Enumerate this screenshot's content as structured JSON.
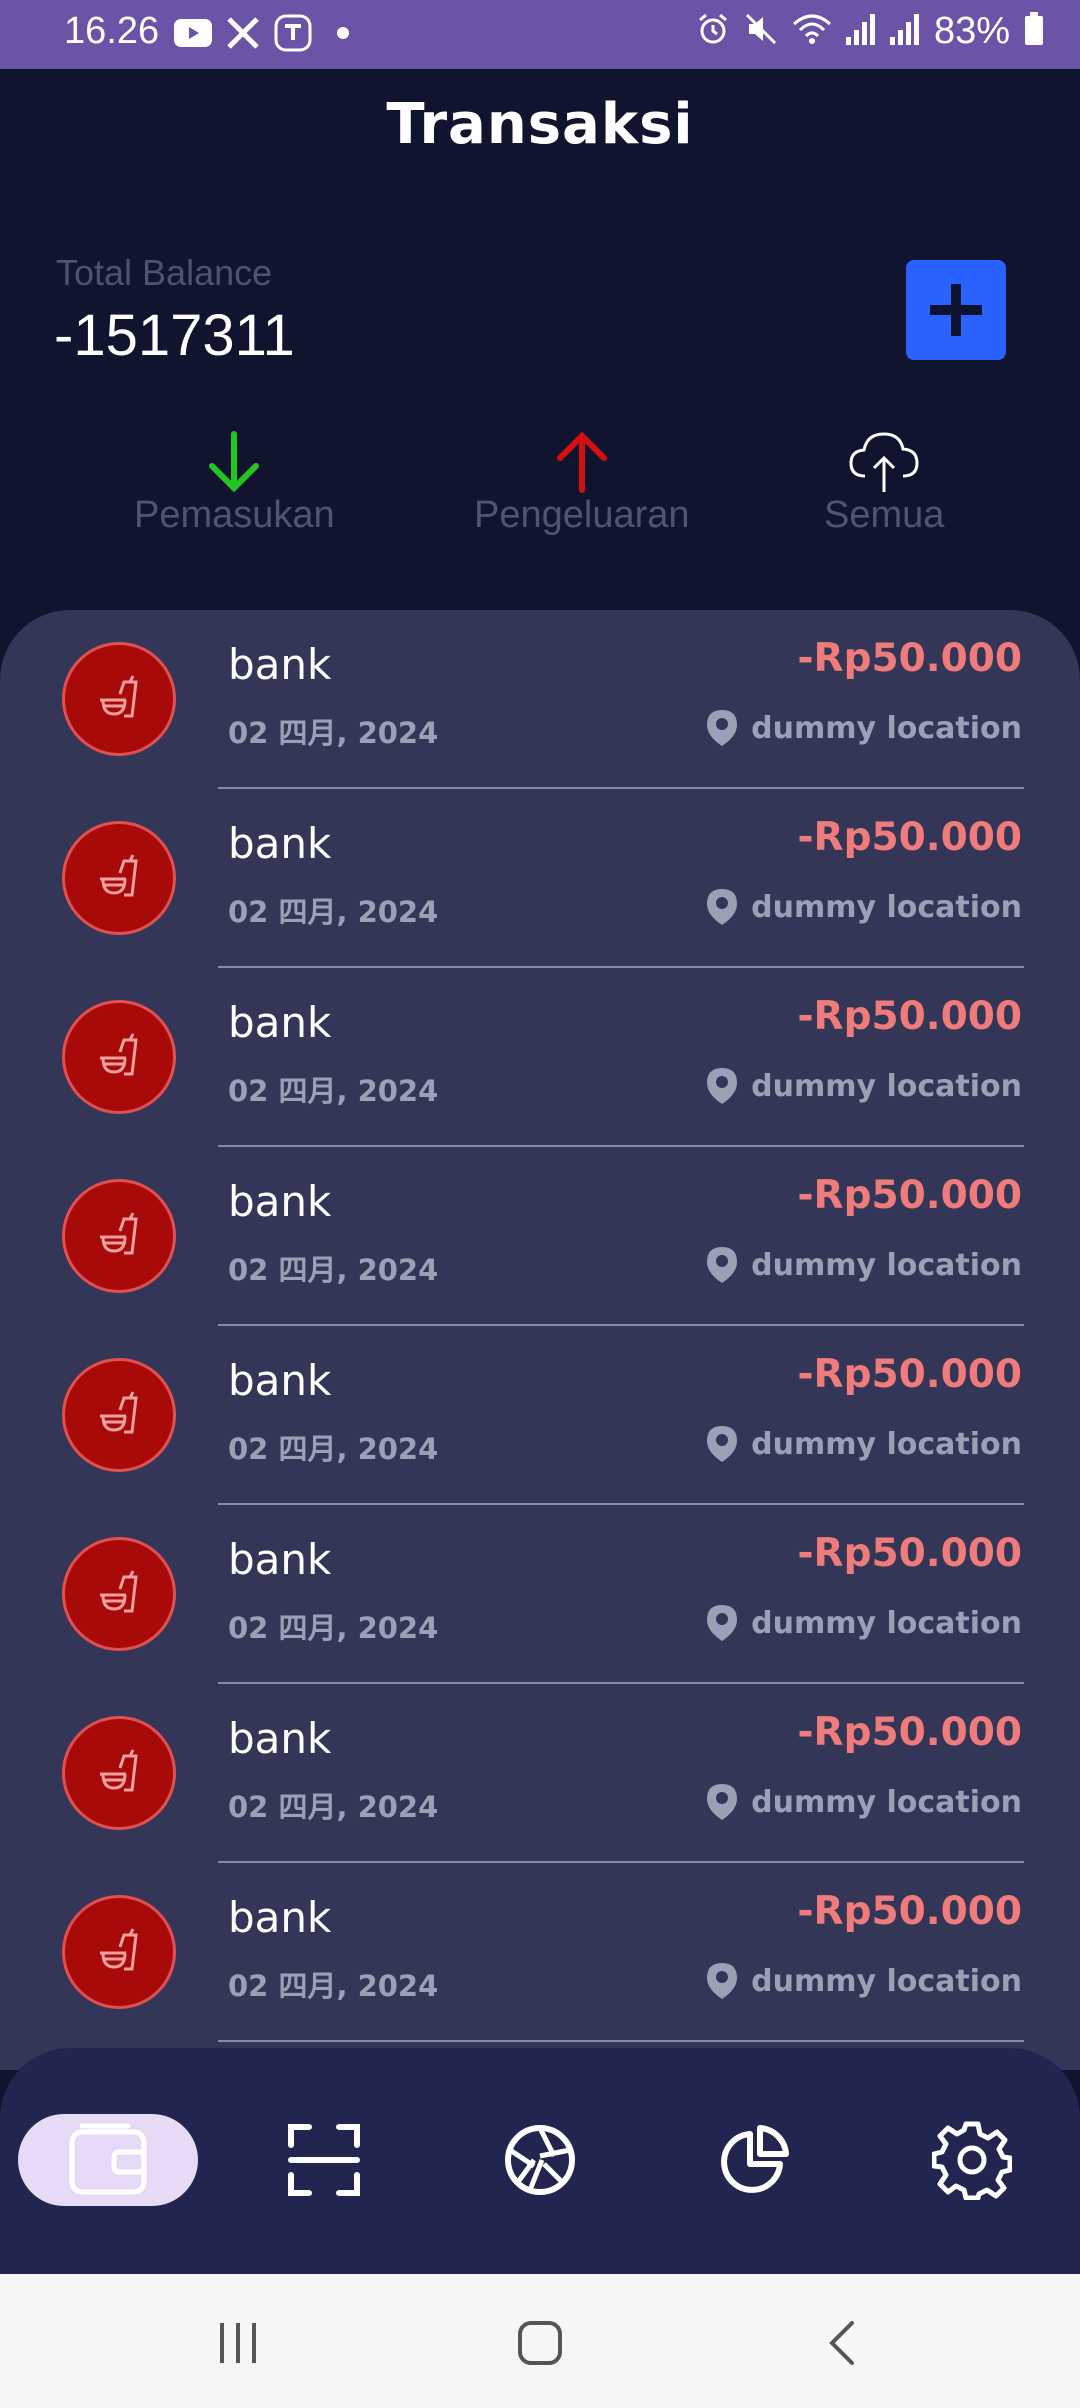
{
  "status_bar": {
    "time": "16.26",
    "battery": "83%",
    "app_icons": [
      "youtube-icon",
      "x-icon",
      "app-icon",
      "dot-icon"
    ],
    "system_icons": [
      "alarm-icon",
      "mute-icon",
      "wifi-icon",
      "signal-icon",
      "signal-icon",
      "battery-icon"
    ]
  },
  "header": {
    "title": "Transaksi"
  },
  "balance": {
    "label": "Total Balance",
    "value": "-1517311"
  },
  "filters": [
    {
      "label": "Pemasukan",
      "icon": "arrow-down-icon",
      "color": "#22c622"
    },
    {
      "label": "Pengeluaran",
      "icon": "arrow-up-icon",
      "color": "#d30f0f"
    },
    {
      "label": "Semua",
      "icon": "cloud-upload-icon",
      "color": "#ffffff"
    }
  ],
  "transactions": [
    {
      "title": "bank",
      "date": "02 四月, 2024",
      "amount": "-Rp50.000",
      "location": "dummy location"
    },
    {
      "title": "bank",
      "date": "02 四月, 2024",
      "amount": "-Rp50.000",
      "location": "dummy location"
    },
    {
      "title": "bank",
      "date": "02 四月, 2024",
      "amount": "-Rp50.000",
      "location": "dummy location"
    },
    {
      "title": "bank",
      "date": "02 四月, 2024",
      "amount": "-Rp50.000",
      "location": "dummy location"
    },
    {
      "title": "bank",
      "date": "02 四月, 2024",
      "amount": "-Rp50.000",
      "location": "dummy location"
    },
    {
      "title": "bank",
      "date": "02 四月, 2024",
      "amount": "-Rp50.000",
      "location": "dummy location"
    },
    {
      "title": "bank",
      "date": "02 四月, 2024",
      "amount": "-Rp50.000",
      "location": "dummy location"
    },
    {
      "title": "bank",
      "date": "02 四月, 2024",
      "amount": "-Rp50.000",
      "location": "dummy location"
    }
  ],
  "bottom_nav": {
    "items": [
      "wallet-icon",
      "scan-icon",
      "camera-aperture-icon",
      "pie-chart-icon",
      "settings-icon"
    ],
    "active": "wallet-icon"
  },
  "colors": {
    "background": "#11142f",
    "card": "#333657",
    "accent": "#2962ff",
    "expense": "#f07b7b",
    "status_bar": "#6b54a8"
  }
}
